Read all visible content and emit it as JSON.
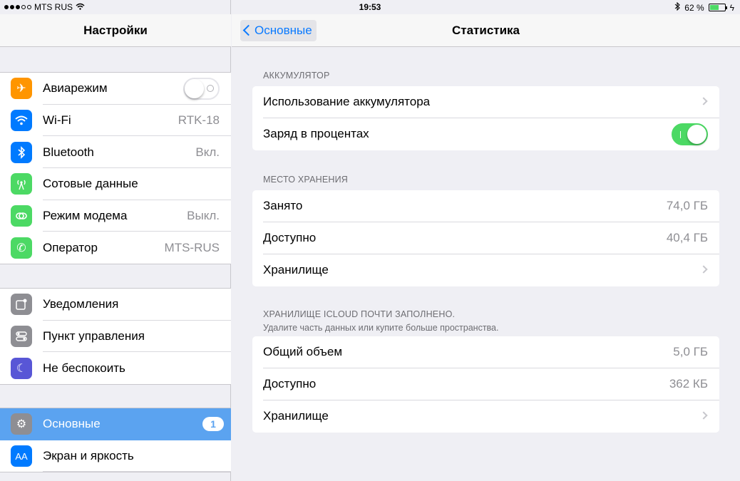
{
  "status_bar": {
    "carrier": "MTS RUS",
    "time": "19:53",
    "battery_percent": "62 %",
    "battery_level": 0.62
  },
  "left": {
    "title": "Настройки",
    "group1": [
      {
        "label": "Авиарежим",
        "icon": "airplane-icon",
        "color": "#ff9500",
        "toggle": false
      },
      {
        "label": "Wi-Fi",
        "icon": "wifi-icon",
        "color": "#007aff",
        "value": "RTK-18"
      },
      {
        "label": "Bluetooth",
        "icon": "bluetooth-icon",
        "color": "#007aff",
        "value": "Вкл."
      },
      {
        "label": "Сотовые данные",
        "icon": "antenna-icon",
        "color": "#4cd964"
      },
      {
        "label": "Режим модема",
        "icon": "hotspot-icon",
        "color": "#4cd964",
        "value": "Выкл."
      },
      {
        "label": "Оператор",
        "icon": "phone-icon",
        "color": "#4cd964",
        "value": "MTS-RUS"
      }
    ],
    "group2": [
      {
        "label": "Уведомления",
        "icon": "notifications-icon",
        "color": "#8e8e93"
      },
      {
        "label": "Пункт управления",
        "icon": "control-center-icon",
        "color": "#8e8e93"
      },
      {
        "label": "Не беспокоить",
        "icon": "moon-icon",
        "color": "#5856d6"
      }
    ],
    "group3": [
      {
        "label": "Основные",
        "icon": "gear-icon",
        "color": "#8e8e93",
        "badge": "1",
        "selected": true
      },
      {
        "label": "Экран и яркость",
        "icon": "display-icon",
        "color": "#007aff"
      }
    ]
  },
  "right": {
    "back_label": "Основные",
    "title": "Статистика",
    "battery_section": {
      "header": "Аккумулятор",
      "rows": [
        {
          "label": "Использование аккумулятора",
          "chevron": true
        },
        {
          "label": "Заряд в процентах",
          "toggle": true
        }
      ]
    },
    "storage_section": {
      "header": "Место хранения",
      "rows": [
        {
          "label": "Занято",
          "value": "74,0 ГБ"
        },
        {
          "label": "Доступно",
          "value": "40,4 ГБ"
        },
        {
          "label": "Хранилище",
          "chevron": true
        }
      ]
    },
    "icloud_section": {
      "header": "Хранилище iCloud почти заполнено.",
      "subheader": "Удалите часть данных или купите больше пространства.",
      "rows": [
        {
          "label": "Общий объем",
          "value": "5,0 ГБ"
        },
        {
          "label": "Доступно",
          "value": "362 КБ"
        },
        {
          "label": "Хранилище",
          "chevron": true
        }
      ]
    }
  }
}
